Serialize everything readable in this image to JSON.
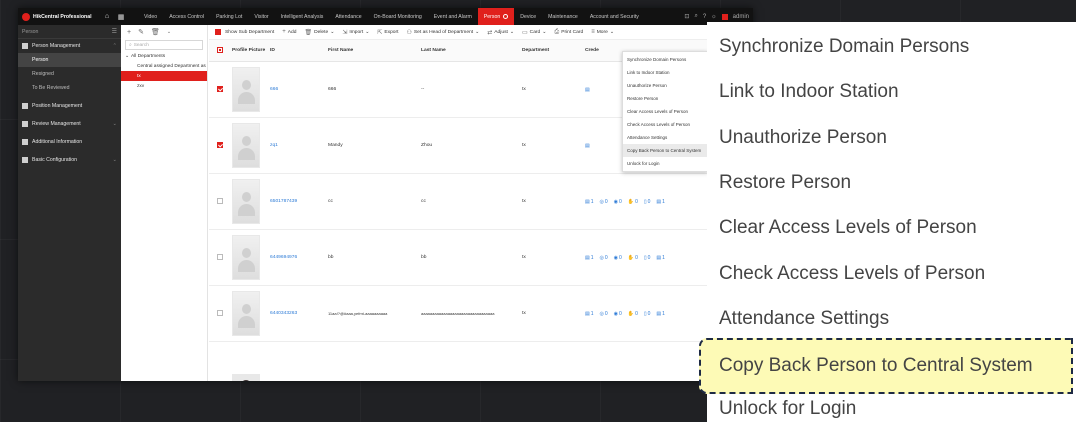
{
  "app": {
    "brand": "HikCentral Professional",
    "nav": [
      "Video",
      "Access Control",
      "Parking Lot",
      "Visitor",
      "Intelligent Analysis",
      "Attendance",
      "On-Board Monitoring",
      "Event and Alarm",
      "Person",
      "Device",
      "Maintenance",
      "Account and Security"
    ],
    "active_nav": "Person",
    "user": "admin"
  },
  "sidebar": {
    "header": "Person",
    "groups": [
      {
        "label": "Person Management",
        "items": [
          "Person",
          "Resigned",
          "To Be Reviewed"
        ]
      },
      {
        "label": "Position Management"
      },
      {
        "label": "Review Management"
      },
      {
        "label": "Additional Information"
      },
      {
        "label": "Basic Configuration"
      }
    ]
  },
  "tree": {
    "search_placeholder": "Search",
    "root": "All Departments",
    "nodes": [
      "Central assigned Department as",
      "tx",
      "zxv"
    ]
  },
  "toolbar": {
    "show_sub": "Show Sub Department",
    "add": "Add",
    "delete": "Delete",
    "import": "Import",
    "export": "Export",
    "set_head": "Set as Head of Department",
    "adjust": "Adjust",
    "card": "Card",
    "print_card": "Print Card",
    "more": "More"
  },
  "table": {
    "headers": {
      "pic": "Profile Picture",
      "id": "ID",
      "first": "First Name",
      "last": "Last Name",
      "dept": "Department",
      "cred": "Crede"
    },
    "rows": [
      {
        "id": "666",
        "first": "666",
        "last": "--",
        "dept": "tx",
        "checked": true
      },
      {
        "id": "zq1",
        "first": "Mandy",
        "last": "Zhou",
        "dept": "tx",
        "checked": true
      },
      {
        "id": "6501787439",
        "first": "cc",
        "last": "cc",
        "dept": "tx",
        "checked": false
      },
      {
        "id": "6449694976",
        "first": "bb",
        "last": "bb",
        "dept": "tx",
        "checked": false
      },
      {
        "id": "6440343263",
        "first": "11aa!?@#aaa,yefmt-aaaaaaaaaa",
        "last": "aaaaaaaaaaaaaaaaaaaaaaaaaaaaaaaaa",
        "dept": "tx",
        "checked": false
      }
    ],
    "cred_counts": [
      "1",
      "0",
      "0",
      "0",
      "0",
      "1"
    ]
  },
  "more_menu": {
    "items": [
      "Synchronize Domain Persons",
      "Link to Indoor Station",
      "Unauthorize Person",
      "Restore Person",
      "Clear Access Levels of Person",
      "Check Access Levels of Person",
      "Attendance Settings",
      "Copy Back Person to Central System",
      "Unlock for Login"
    ],
    "highlighted": "Copy Back Person to Central System"
  },
  "colors": {
    "accent": "#e0201c",
    "link": "#2d7bd6",
    "highlight": "#fdfab6"
  }
}
